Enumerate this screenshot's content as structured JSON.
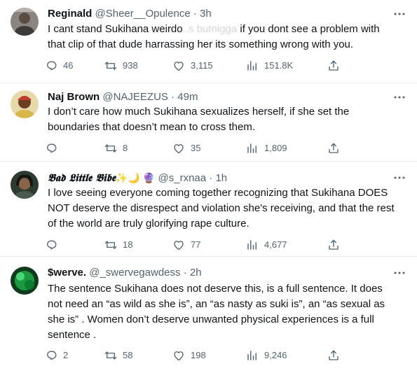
{
  "tweets": [
    {
      "name": "Reginald",
      "handle": "@Sheer__Opulence",
      "separator": "·",
      "time": "3h",
      "text_before": "I cant stand Sukihana weirdo",
      "text_redacted_1": " ..s but ",
      "text_redacted_2": "nigga",
      "text_after": " if you dont see a problem with\nthat clip of that dude harrassing her its something wrong with you.",
      "replies": "46",
      "retweets": "938",
      "likes": "3,115",
      "views": "151.8K",
      "avatar_color": "#6b625c"
    },
    {
      "name": "Naj Brown",
      "handle": "@NAJEEZUS",
      "separator": "·",
      "time": "49m",
      "text": "I don’t care how much Sukihana sexualizes herself, if she set the\nboundaries that doesn’t mean to cross them.",
      "replies": "",
      "retweets": "8",
      "likes": "35",
      "views": "1,809",
      "avatar_color": "#c9a44a"
    },
    {
      "name": "𝕭𝖆𝖉 𝕷𝖎𝖙𝖙𝖑𝖊 𝕭𝖎𝖇𝖊",
      "name_emojis": "✨🌙",
      "name_emoji_2": "🔮",
      "handle": "@s_rxnaa",
      "separator": "·",
      "time": "1h",
      "text": "I love seeing everyone coming together recognizing that Sukihana DOES\nNOT deserve the disrespect and violation she's receiving, and that the rest\nof the world are truly glorifying rape culture.",
      "replies": "",
      "retweets": "18",
      "likes": "77",
      "views": "4,677",
      "avatar_color": "#3a4a3c"
    },
    {
      "name": "$werve.",
      "handle": "@_swervegawdess",
      "separator": "·",
      "time": "2h",
      "text": "The sentence Sukihana does not deserve this, is a full sentence. It does\nnot need an “as wild as she is”, an “as nasty as suki is”, an “as sexual as\nshe is” . Women don’t deserve unwanted physical experiences is a full\nsentence .",
      "replies": "2",
      "retweets": "58",
      "likes": "198",
      "views": "9,246",
      "avatar_color": "#1f9a3a"
    }
  ],
  "icons": {
    "reply": "reply-icon",
    "retweet": "retweet-icon",
    "like": "heart-icon",
    "views": "views-icon",
    "share": "share-icon",
    "more": "more-icon"
  },
  "colors": {
    "text": "#0f1419",
    "secondary": "#536471",
    "divider": "#e8ecee"
  }
}
